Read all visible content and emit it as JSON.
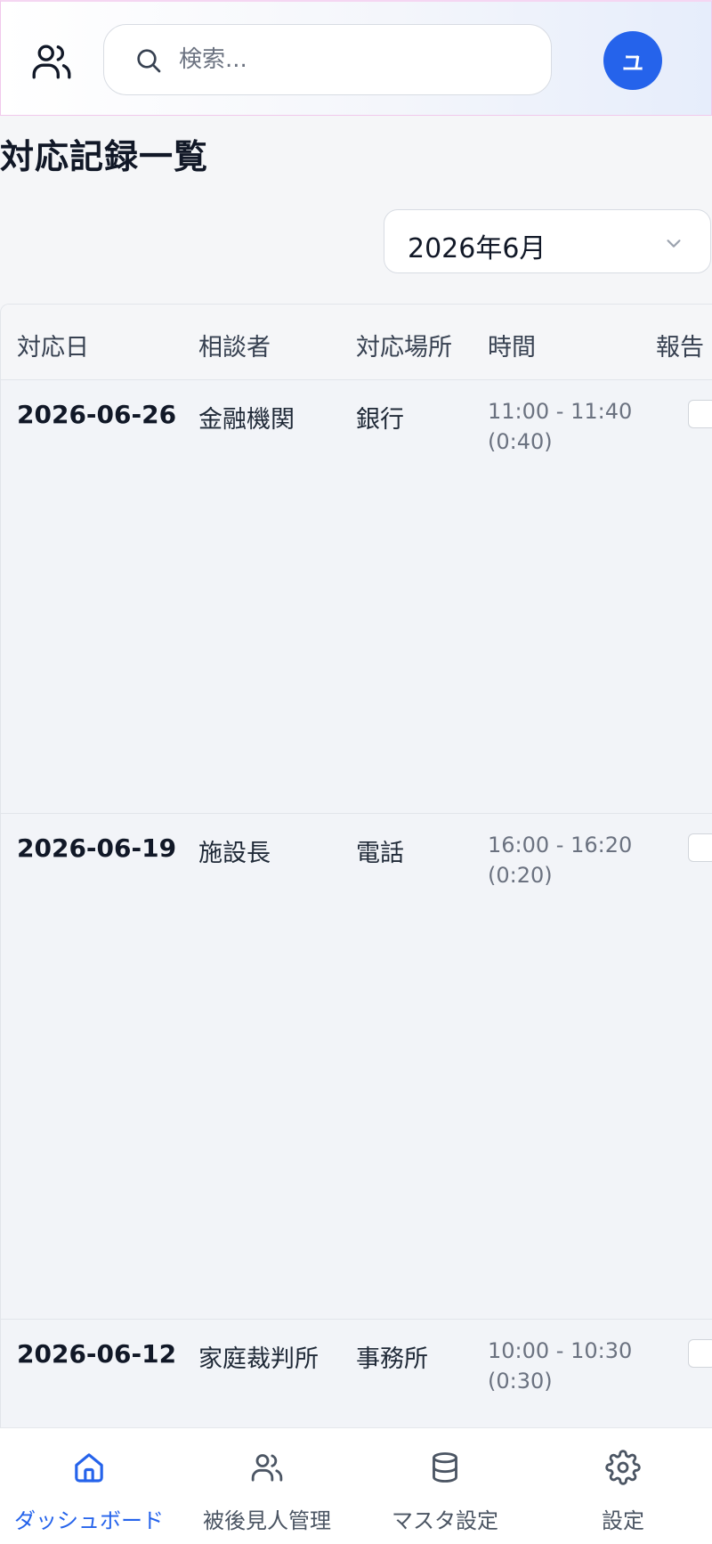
{
  "header": {
    "search_placeholder": "検索...",
    "avatar_initial": "ユ"
  },
  "page": {
    "title": "対応記録一覧",
    "month_select": "2026年6月"
  },
  "table": {
    "columns": [
      "対応日",
      "相談者",
      "対応場所",
      "時間",
      "報告"
    ],
    "rows": [
      {
        "date": "2026-06-26",
        "consultant": "金融機関",
        "place": "銀行",
        "time_range": "11:00 - 11:40",
        "duration": "(0:40)"
      },
      {
        "date": "2026-06-19",
        "consultant": "施設長",
        "place": "電話",
        "time_range": "16:00 - 16:20",
        "duration": "(0:20)"
      },
      {
        "date": "2026-06-12",
        "consultant": "家庭裁判所",
        "place": "事務所",
        "time_range": "10:00 - 10:30",
        "duration": "(0:30)"
      }
    ]
  },
  "bottom_nav": {
    "items": [
      {
        "label": "ダッシュボード",
        "icon": "home-icon",
        "active": true
      },
      {
        "label": "被後見人管理",
        "icon": "users-icon",
        "active": false
      },
      {
        "label": "マスタ設定",
        "icon": "database-icon",
        "active": false
      },
      {
        "label": "設定",
        "icon": "gear-icon",
        "active": false
      }
    ]
  },
  "colors": {
    "accent": "#2563eb",
    "text": "#111827",
    "muted": "#6b7280",
    "background": "#f5f6f8"
  }
}
